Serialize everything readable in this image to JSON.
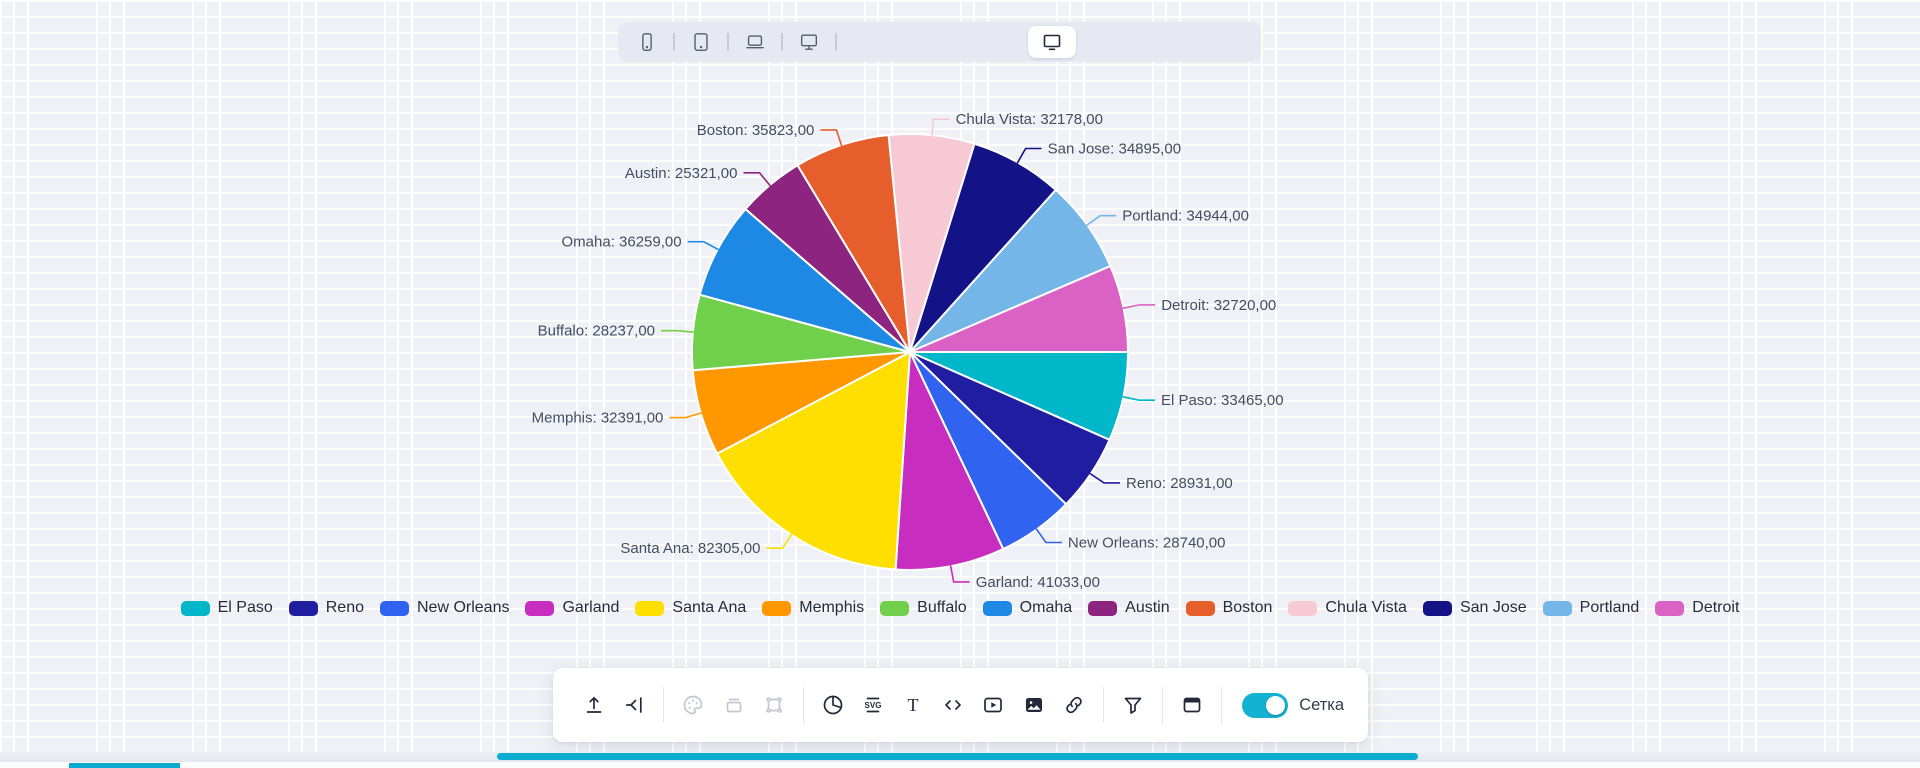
{
  "device_toolbar": {
    "icons": [
      "smartphone",
      "tablet",
      "laptop",
      "desktop"
    ],
    "active_device": "desktop"
  },
  "chart_data": {
    "type": "pie",
    "title": "",
    "legend_position": "bottom",
    "start_angle_deg": 0,
    "direction": "clockwise",
    "label_format": "{category}: {value},00",
    "label_color": "#454d60",
    "slices": [
      {
        "label": "El Paso",
        "value": 33465,
        "display": "El Paso: 33465,00",
        "color": "#00b6c9"
      },
      {
        "label": "Reno",
        "value": 28931,
        "display": "Reno: 28931,00",
        "color": "#201da1"
      },
      {
        "label": "New Orleans",
        "value": 28740,
        "display": "New Orleans: 28740,00",
        "color": "#2f63f0"
      },
      {
        "label": "Garland",
        "value": 41033,
        "display": "Garland: 41033,00",
        "color": "#c72ec0"
      },
      {
        "label": "Santa Ana",
        "value": 82305,
        "display": "Santa Ana: 82305,00",
        "color": "#ffdf00"
      },
      {
        "label": "Memphis",
        "value": 32391,
        "display": "Memphis: 32391,00",
        "color": "#ff9800"
      },
      {
        "label": "Buffalo",
        "value": 28237,
        "display": "Buffalo: 28237,00",
        "color": "#70d04b"
      },
      {
        "label": "Omaha",
        "value": 36259,
        "display": "Omaha: 36259,00",
        "color": "#1e88e5"
      },
      {
        "label": "Austin",
        "value": 25321,
        "display": "Austin: 25321,00",
        "color": "#8d2580"
      },
      {
        "label": "Boston",
        "value": 35823,
        "display": "Boston: 35823,00",
        "color": "#e55e2b"
      },
      {
        "label": "Chula Vista",
        "value": 32178,
        "display": "Chula Vista: 32178,00",
        "color": "#f7c9d4"
      },
      {
        "label": "San Jose",
        "value": 34895,
        "display": "San Jose: 34895,00",
        "color": "#131286"
      },
      {
        "label": "Portland",
        "value": 34944,
        "display": "Portland: 34944,00",
        "color": "#74b6e8"
      },
      {
        "label": "Detroit",
        "value": 32720,
        "display": "Detroit: 32720,00",
        "color": "#da62c4"
      }
    ]
  },
  "bottom_toolbar": {
    "icons": [
      "upload",
      "collapse-left",
      "palette",
      "archive",
      "transform",
      "pie-chart",
      "svg",
      "text",
      "code",
      "video",
      "image",
      "link",
      "filter",
      "window"
    ],
    "disabled_icons": [
      "palette",
      "archive",
      "transform"
    ],
    "grid_toggle": {
      "label": "Сетка",
      "on": true,
      "color": "#14b2d2"
    }
  },
  "accent_color": "#0aadcf"
}
